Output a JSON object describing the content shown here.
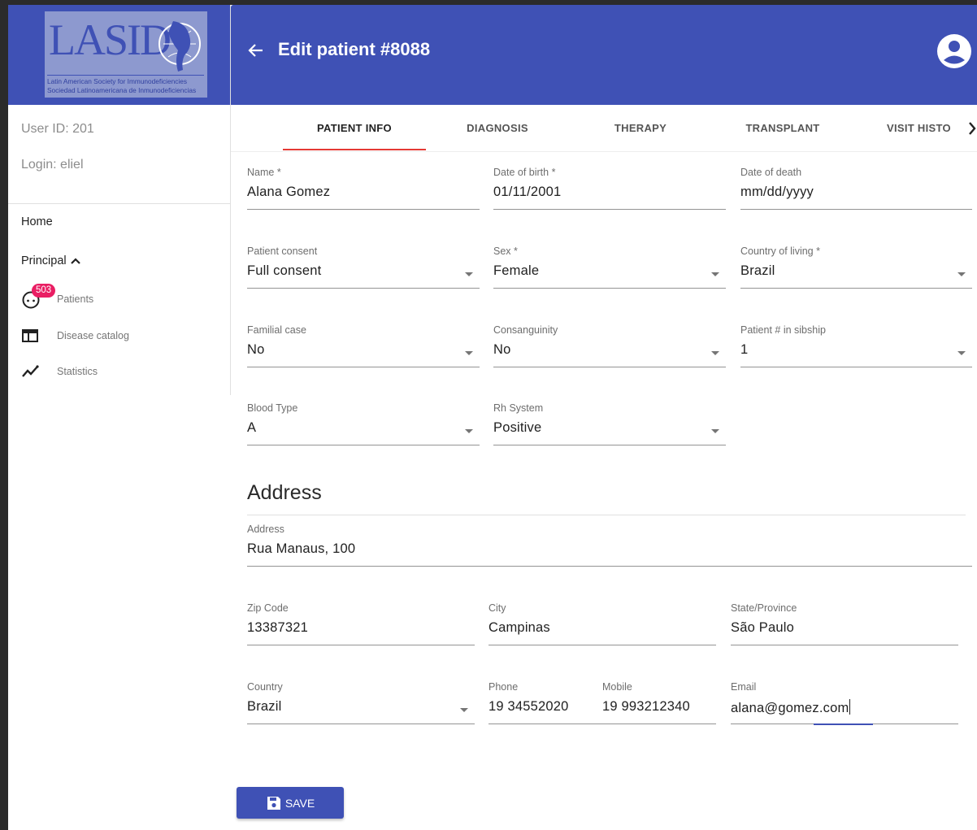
{
  "sidebar": {
    "logo": {
      "text": "LASID",
      "subtitle_en": "Latin American Society for Immunodeficiencies",
      "subtitle_es": "Sociedad Latinoamericana de Inmunodeficiencias"
    },
    "user_id": "User ID: 201",
    "login": "Login: eliel",
    "nav": {
      "home": "Home",
      "principal": "Principal",
      "items": [
        {
          "label": "Patients",
          "badge": "503",
          "icon": "face-icon"
        },
        {
          "label": "Disease catalog",
          "icon": "catalog-icon"
        },
        {
          "label": "Statistics",
          "icon": "statistics-icon"
        }
      ]
    }
  },
  "header": {
    "title": "Edit patient #8088",
    "color": "#3f51b5"
  },
  "tabs": [
    {
      "label": "PATIENT INFO",
      "active": true
    },
    {
      "label": "DIAGNOSIS"
    },
    {
      "label": "THERAPY"
    },
    {
      "label": "TRANSPLANT"
    },
    {
      "label": "VISIT HISTO"
    }
  ],
  "patient": {
    "name": {
      "label": "Name *",
      "value": "Alana Gomez"
    },
    "dob": {
      "label": "Date of birth *",
      "value": "01/11/2001"
    },
    "dod": {
      "label": "Date of death",
      "value": "mm/dd/yyyy"
    },
    "consent": {
      "label": "Patient consent",
      "value": "Full consent"
    },
    "sex": {
      "label": "Sex *",
      "value": "Female"
    },
    "country_living": {
      "label": "Country of living *",
      "value": "Brazil"
    },
    "familial_case": {
      "label": "Familial case",
      "value": "No"
    },
    "consanguinity": {
      "label": "Consanguinity",
      "value": "No"
    },
    "sibship": {
      "label": "Patient # in sibship",
      "value": "1"
    },
    "blood_type": {
      "label": "Blood Type",
      "value": "A"
    },
    "rh_system": {
      "label": "Rh System",
      "value": "Positive"
    }
  },
  "address": {
    "section_title": "Address",
    "address": {
      "label": "Address",
      "value": "Rua Manaus, 100"
    },
    "zip": {
      "label": "Zip Code",
      "value": "13387321"
    },
    "city": {
      "label": "City",
      "value": "Campinas"
    },
    "state": {
      "label": "State/Province",
      "value": "São Paulo"
    },
    "country": {
      "label": "Country",
      "value": "Brazil"
    },
    "phone": {
      "label": "Phone",
      "value": "19 34552020"
    },
    "mobile": {
      "label": "Mobile",
      "value": "19 993212340"
    },
    "email": {
      "label": "Email",
      "value": "alana@gomez.com"
    }
  },
  "actions": {
    "save": "SAVE"
  },
  "colors": {
    "primary": "#3f51b5",
    "tab_indicator": "#e53935",
    "badge": "#e91e63"
  }
}
